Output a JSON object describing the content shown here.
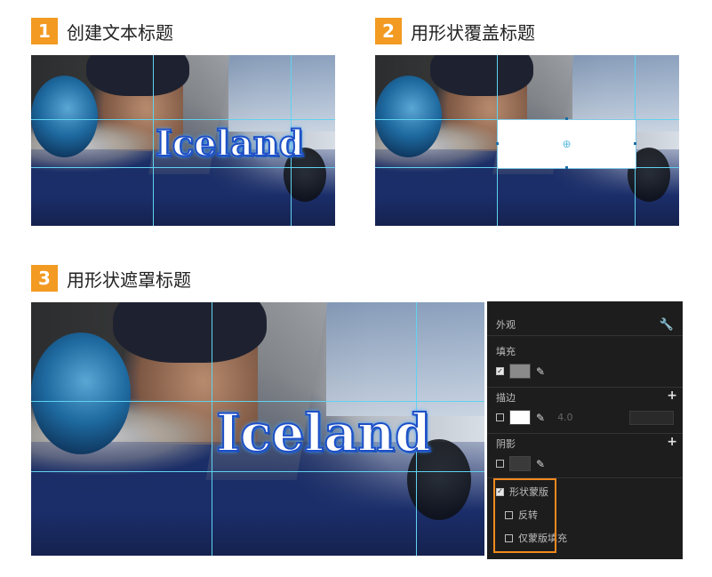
{
  "steps": [
    {
      "number": "1",
      "title": "创建文本标题"
    },
    {
      "number": "2",
      "title": "用形状覆盖标题"
    },
    {
      "number": "3",
      "title": "用形状遮罩标题"
    }
  ],
  "title_text": "Iceland",
  "panel": {
    "header": "外观",
    "header_icon": "wrench-icon",
    "fill_label": "填充",
    "fill_checked": true,
    "fill_color": "#8a8a8a",
    "stroke_label": "描边",
    "stroke_checked": false,
    "stroke_color": "#ffffff",
    "stroke_width": "4.0",
    "shadow_label": "阴影",
    "shadow_checked": false,
    "shadow_color": "#3a3a3a",
    "mask_label": "形状蒙版",
    "mask_checked": true,
    "invert_label": "反转",
    "invert_checked": false,
    "fill_only_label": "仅蒙版填充",
    "fill_only_checked": false
  },
  "colors": {
    "step_badge": "#f29a22",
    "guide": "#5fd3f0",
    "highlight": "#f28a1e"
  }
}
